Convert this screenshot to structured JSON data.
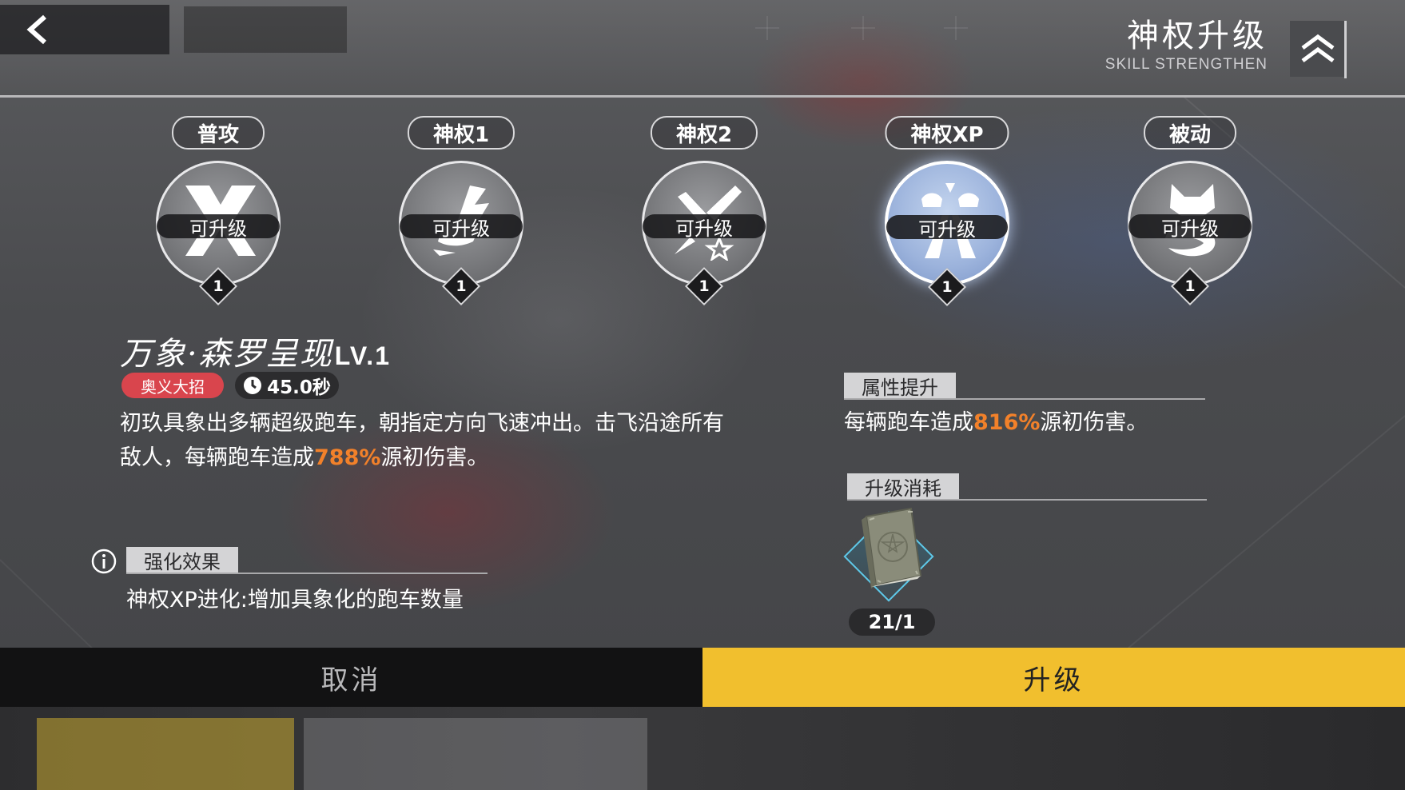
{
  "header": {
    "title": "神权升级",
    "subtitle": "SKILL STRENGTHEN"
  },
  "skills": [
    {
      "tab": "普攻",
      "status": "可升级",
      "level": "1",
      "icon": "crossed-blades-icon",
      "active": false
    },
    {
      "tab": "神权1",
      "status": "可升级",
      "level": "1",
      "icon": "speed-car-icon",
      "active": false
    },
    {
      "tab": "神权2",
      "status": "可升级",
      "level": "1",
      "icon": "rocket-burst-icon",
      "active": false
    },
    {
      "tab": "神权XP",
      "status": "可升级",
      "level": "1",
      "icon": "road-cars-icon",
      "active": true
    },
    {
      "tab": "被动",
      "status": "可升级",
      "level": "1",
      "icon": "fox-swirl-icon",
      "active": false
    }
  ],
  "detail": {
    "name": "万象·森罗呈现",
    "level": "LV.1",
    "type_tag": "奥义大招",
    "cooldown": "45.0秒",
    "desc_pre": "初玖具象出多辆超级跑车，朝指定方向飞速冲出。击飞沿途所有敌人，每辆跑车造成",
    "desc_value": "788%",
    "desc_post": "源初伤害。"
  },
  "enhance": {
    "header": "强化效果",
    "text": "神权XP进化:增加具象化的跑车数量"
  },
  "attribute": {
    "header": "属性提升",
    "pre": "每辆跑车造成",
    "value": "816%",
    "post": "源初伤害。"
  },
  "cost": {
    "header": "升级消耗",
    "item_icon": "grimoire-book-icon",
    "count": "21/1"
  },
  "buttons": {
    "cancel": "取消",
    "upgrade": "升级"
  },
  "colors": {
    "highlight": "#f2812a",
    "upgrade_button": "#f1bf2e",
    "ult_tag": "#d9454d",
    "active_skill": "#9cb3dc"
  }
}
